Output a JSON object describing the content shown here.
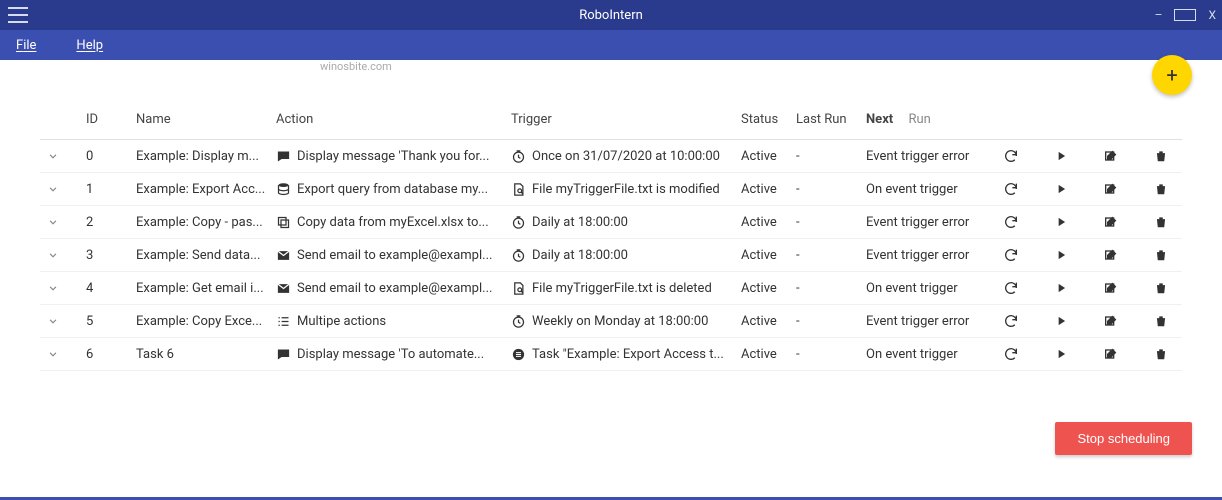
{
  "titlebar": {
    "title": "RoboIntern"
  },
  "menubar": {
    "file": "File",
    "help": "Help"
  },
  "watermark": "winosbite.com",
  "fab_label": "+",
  "columns": {
    "id": "ID",
    "name": "Name",
    "action": "Action",
    "trigger": "Trigger",
    "status": "Status",
    "last_run": "Last Run",
    "next": "Next",
    "run": "Run"
  },
  "rows": [
    {
      "id": "0",
      "name": "Example: Display m...",
      "action_icon": "message",
      "action": "Display message 'Thank you for...",
      "trigger_icon": "clock",
      "trigger": "Once on 31/07/2020 at 10:00:00",
      "status": "Active",
      "last_run": "-",
      "next_run": "Event trigger error"
    },
    {
      "id": "1",
      "name": "Example: Export Acc...",
      "action_icon": "db",
      "action": "Export query from database my...",
      "trigger_icon": "file",
      "trigger": "File myTriggerFile.txt is modified",
      "status": "Active",
      "last_run": "-",
      "next_run": "On event trigger"
    },
    {
      "id": "2",
      "name": "Example: Copy - pas...",
      "action_icon": "copy",
      "action": "Copy data from myExcel.xlsx to...",
      "trigger_icon": "clock",
      "trigger": "Daily at 18:00:00",
      "status": "Active",
      "last_run": "-",
      "next_run": "Event trigger error"
    },
    {
      "id": "3",
      "name": "Example: Send data...",
      "action_icon": "mail",
      "action": "Send email to example@exampl...",
      "trigger_icon": "clock",
      "trigger": "Daily at 18:00:00",
      "status": "Active",
      "last_run": "-",
      "next_run": "Event trigger error"
    },
    {
      "id": "4",
      "name": "Example: Get email i...",
      "action_icon": "mail",
      "action": "Send email to example@exampl...",
      "trigger_icon": "file",
      "trigger": "File myTriggerFile.txt is deleted",
      "status": "Active",
      "last_run": "-",
      "next_run": "On event trigger"
    },
    {
      "id": "5",
      "name": "Example: Copy Exce...",
      "action_icon": "list",
      "action": "Multipe actions",
      "trigger_icon": "clock",
      "trigger": "Weekly on Monday at 18:00:00",
      "status": "Active",
      "last_run": "-",
      "next_run": "Event trigger error"
    },
    {
      "id": "6",
      "name": "Task 6",
      "action_icon": "message",
      "action": "Display message 'To automate...",
      "trigger_icon": "task",
      "trigger": "Task \"Example: Export Access t...",
      "status": "Active",
      "last_run": "-",
      "next_run": "On event trigger"
    }
  ],
  "stop_button": "Stop scheduling"
}
